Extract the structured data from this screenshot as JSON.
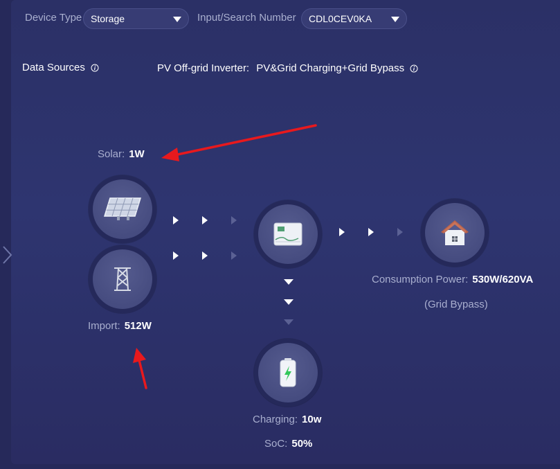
{
  "filters": {
    "device_type_label": "Device Type",
    "device_type_value": "Storage",
    "search_label": "Input/Search Number",
    "search_value": "CDL0CEV0KA"
  },
  "header": {
    "data_sources_label": "Data Sources",
    "inverter_label": "PV Off-grid Inverter:",
    "inverter_mode": "PV&Grid Charging+Grid Bypass"
  },
  "solar": {
    "label": "Solar:",
    "value": "1W"
  },
  "grid": {
    "label": "Import:",
    "value": "512W"
  },
  "battery": {
    "charging_label": "Charging:",
    "charging_value": "10w",
    "soc_label": "SoC:",
    "soc_value": "50%"
  },
  "consumption": {
    "label": "Consumption Power:",
    "value": "530W/620VA",
    "note": "(Grid Bypass)"
  },
  "icons": {
    "solar": "solar-panel-icon",
    "grid": "power-tower-icon",
    "inverter": "inverter-icon",
    "home": "house-icon",
    "battery": "battery-icon"
  },
  "colors": {
    "background": "#26295a",
    "panel": "#2e3570",
    "node_ring": "#25295a",
    "node_inner": "#464c80",
    "inactive_arrow": "#5b6194",
    "annotation_arrow": "#e8191d",
    "battery_bolt": "#33c75a"
  }
}
